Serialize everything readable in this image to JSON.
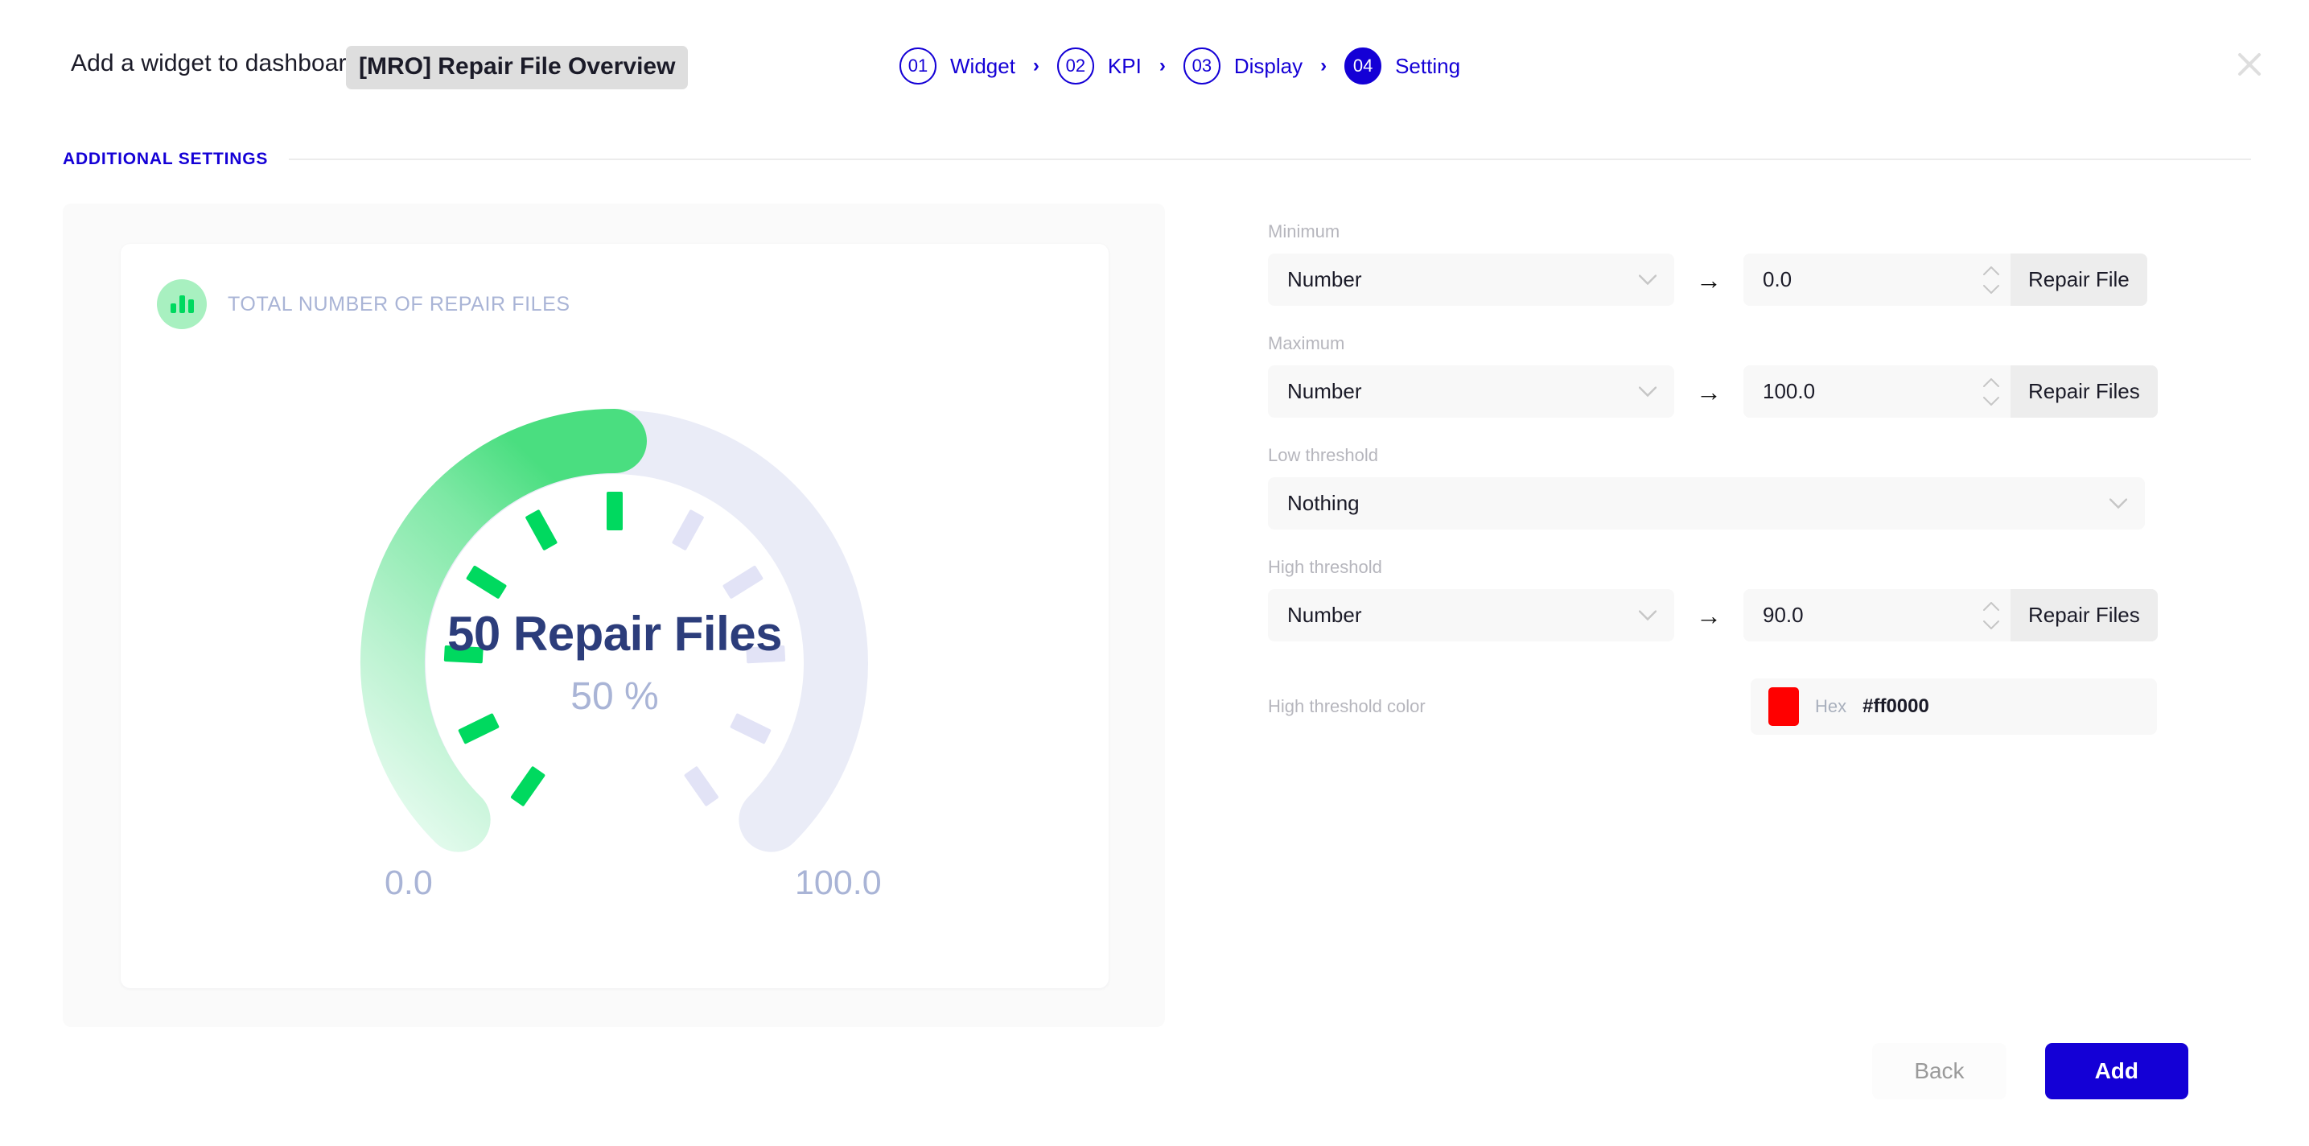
{
  "header": {
    "title": "Add a widget to dashboard",
    "widget_name": "[MRO] Repair File Overview",
    "close_icon": "close-icon",
    "steps": [
      {
        "number": "01",
        "label": "Widget",
        "active": false
      },
      {
        "number": "02",
        "label": "KPI",
        "active": false
      },
      {
        "number": "03",
        "label": "Display",
        "active": false
      },
      {
        "number": "04",
        "label": "Setting",
        "active": true
      }
    ],
    "step_separator": "›"
  },
  "section": {
    "label": "ADDITIONAL SETTINGS"
  },
  "preview": {
    "kpi_icon": "bar-chart-icon",
    "title": "TOTAL NUMBER OF REPAIR FILES",
    "value_text": "50 Repair Files",
    "percent_text": "50 %",
    "min_label": "0.0",
    "max_label": "100.0"
  },
  "chart_data": {
    "type": "gauge",
    "title": "TOTAL NUMBER OF REPAIR FILES",
    "value": 50,
    "value_label": "50 Repair Files",
    "percent": 50,
    "percent_label": "50 %",
    "min": 0.0,
    "max": 100.0,
    "min_label": "0.0",
    "max_label": "100.0",
    "unit": "Repair Files",
    "start_angle_deg": 215,
    "sweep_deg": 290,
    "tick_count": 11,
    "active_color": "#00d95f",
    "active_gradient": [
      "#e9fbf0",
      "#00d95f"
    ],
    "track_color": "#eaecf7",
    "tick_active_color": "#00d95f",
    "tick_inactive_color": "#e2e3f6",
    "value_color": "#2c3d7b",
    "percent_color": "#a9b4d6"
  },
  "settings": {
    "minimum": {
      "label": "Minimum",
      "type": "Number",
      "arrow": "→",
      "value": "0.0",
      "suffix": "Repair File"
    },
    "maximum": {
      "label": "Maximum",
      "type": "Number",
      "arrow": "→",
      "value": "100.0",
      "suffix": "Repair Files"
    },
    "low_threshold": {
      "label": "Low threshold",
      "type": "Nothing"
    },
    "high_threshold": {
      "label": "High threshold",
      "type": "Number",
      "arrow": "→",
      "value": "90.0",
      "suffix": "Repair Files"
    },
    "high_threshold_color": {
      "label": "High threshold color",
      "hex_label": "Hex",
      "hex_value": "#ff0000",
      "swatch_color": "#ff0000"
    }
  },
  "footer": {
    "back_label": "Back",
    "add_label": "Add"
  },
  "colors": {
    "accent": "#1400d6",
    "green": "#00d95f",
    "navy": "#2c3d7b",
    "muted": "#a9b4d6",
    "danger": "#ff0000"
  }
}
